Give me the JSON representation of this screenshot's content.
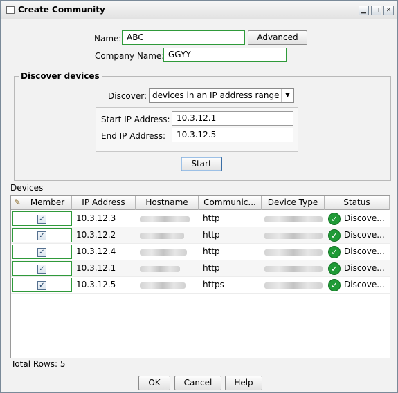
{
  "window": {
    "title": "Create Community"
  },
  "form": {
    "name_label": "Name:",
    "name_value": "ABC",
    "advanced_label": "Advanced",
    "company_label": "Company Name:",
    "company_value": "GGYY"
  },
  "discover": {
    "group_title": "Discover devices",
    "discover_label": "Discover:",
    "discover_value": "devices in an IP address range",
    "start_ip_label": "Start IP Address:",
    "start_ip_value": "10.3.12.1",
    "end_ip_label": "End IP Address:",
    "end_ip_value": "10.3.12.5",
    "start_button": "Start"
  },
  "devices": {
    "section_label": "Devices",
    "columns": [
      "Member",
      "IP Address",
      "Hostname",
      "Communic...",
      "Device Type",
      "Status"
    ],
    "rows": [
      {
        "ip": "10.3.12.3",
        "community": "http",
        "status": "Discove..."
      },
      {
        "ip": "10.3.12.2",
        "community": "http",
        "status": "Discove..."
      },
      {
        "ip": "10.3.12.4",
        "community": "http",
        "status": "Discove..."
      },
      {
        "ip": "10.3.12.1",
        "community": "http",
        "status": "Discove..."
      },
      {
        "ip": "10.3.12.5",
        "community": "https",
        "status": "Discove..."
      }
    ],
    "total_rows": "Total Rows: 5"
  },
  "buttons": {
    "ok": "OK",
    "cancel": "Cancel",
    "help": "Help"
  },
  "icons": {
    "window": "window-icon",
    "minimize": "minimize-icon",
    "maximize": "maximize-icon",
    "close": "close-icon",
    "edit": "pencil-icon",
    "dropdown": "chevron-down-icon",
    "check": "checkbox-checked-icon",
    "status_ok": "green-check-icon"
  },
  "colors": {
    "focus_border": "#2f9a3a",
    "status_ok": "#1f9a36"
  }
}
